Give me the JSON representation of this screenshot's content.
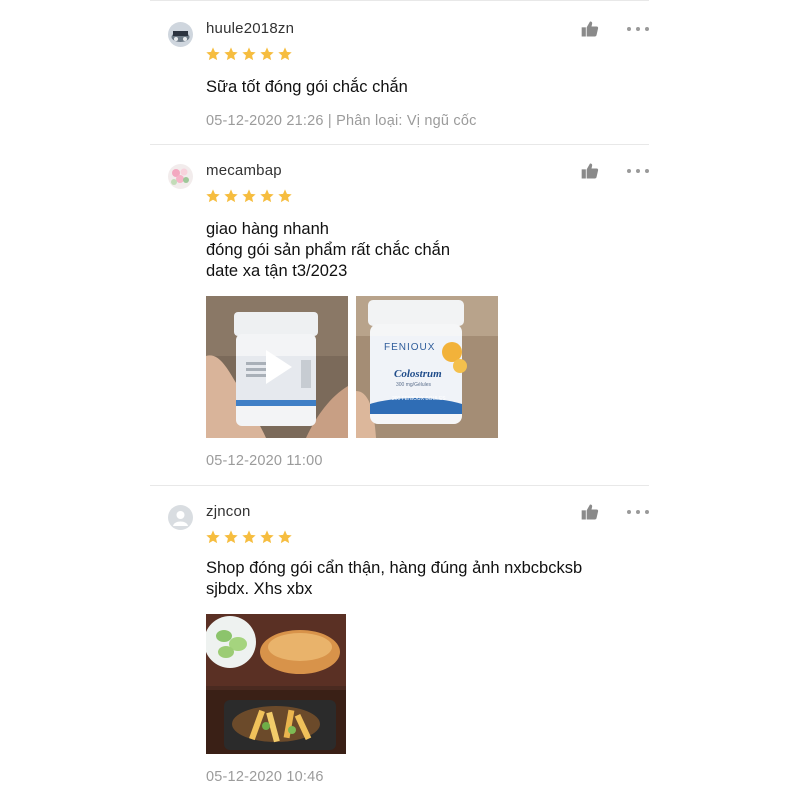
{
  "reviews": [
    {
      "username": "huule2018zn",
      "rating": 5,
      "comment": "Sữa tốt đóng gói chắc chắn",
      "date": "05-12-2020 21:26",
      "variation": "| Phân loại: Vị ngũ cốc"
    },
    {
      "username": "mecambap",
      "rating": 5,
      "comment": "giao hàng nhanh\nđóng gói sản phẩm rất chắc chắn\ndate xa tận t3/2023",
      "date": "05-12-2020 11:00",
      "media": [
        {
          "type": "video",
          "icon": "play-icon"
        },
        {
          "type": "image",
          "brand": "FENIOUX",
          "product": "Colostrum",
          "subtitle": "300 mg/Gélules",
          "caption": "200 FENIOUX BOULES"
        }
      ]
    },
    {
      "username": "zjncon",
      "rating": 5,
      "comment": "Shop đóng gói cẩn thận, hàng đúng ảnh nxbcbcksb\nsjbdx. Xhs xbx",
      "date": "05-12-2020 10:46",
      "media": [
        {
          "type": "image"
        }
      ]
    }
  ],
  "colors": {
    "star": "#f6bd3f",
    "text_meta": "#9b9b9b",
    "divider": "#e8e8e8",
    "icon": "#8a8a8a"
  },
  "icons": {
    "like": "thumbs-up-icon",
    "more": "more-dots-icon",
    "star": "star-icon"
  }
}
